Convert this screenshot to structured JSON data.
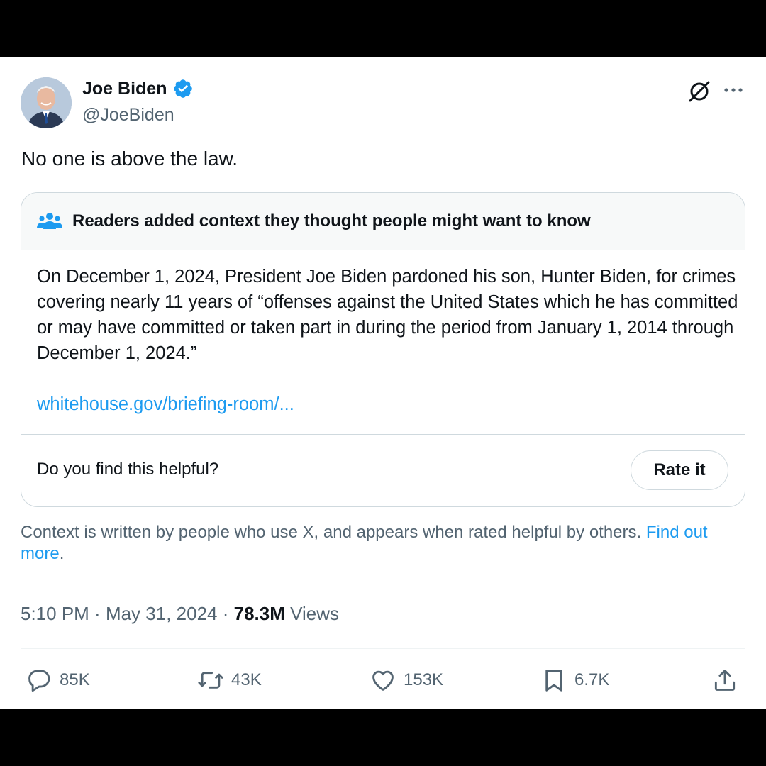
{
  "author": {
    "name": "Joe Biden",
    "handle": "@JoeBiden",
    "verified": true,
    "badge_color": "#1d9bf0"
  },
  "header_icons": [
    "grok-icon",
    "more-options-icon"
  ],
  "tweet": {
    "text": "No one is above the law."
  },
  "community_note": {
    "header": "Readers added context they thought people might want to know",
    "body": "On December 1, 2024, President Joe Biden pardoned his son, Hunter Biden, for crimes covering nearly 11 years of “offenses against the United States which he has committed or may have committed or taken part in during the period from January 1, 2014 through December 1, 2024.”",
    "link": "whitehouse.gov/briefing-room/...",
    "helpful_question": "Do you find this helpful?",
    "rate_button": "Rate it"
  },
  "context_disclaimer": {
    "text": "Context is written by people who use X, and appears when rated helpful by others.",
    "link": "Find out more",
    "period": "."
  },
  "meta": {
    "time": "5:10 PM",
    "separator1": " · ",
    "date": "May 31, 2024",
    "separator2": " · ",
    "views_count": "78.3M",
    "views_label": "Views"
  },
  "actions": {
    "replies": "85K",
    "reposts": "43K",
    "likes": "153K",
    "bookmarks": "6.7K"
  },
  "colors": {
    "accent": "#1d9bf0",
    "text_primary": "#0f1419",
    "text_secondary": "#536471",
    "border": "#cfd9de"
  }
}
